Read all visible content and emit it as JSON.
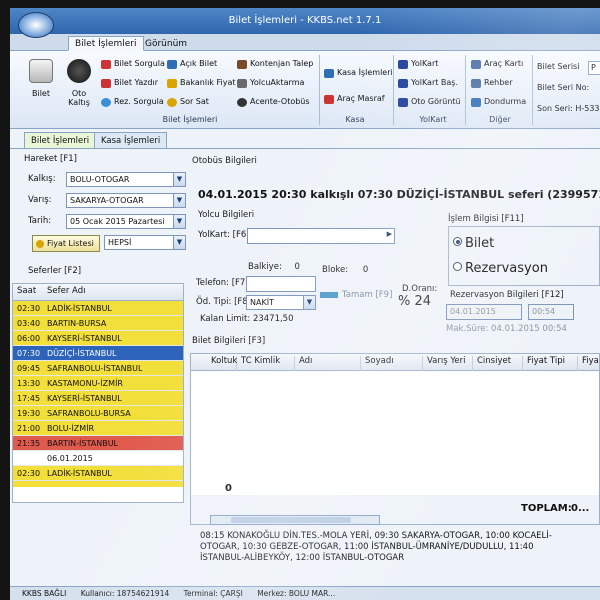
{
  "window": {
    "title": "Bilet İşlemleri - KKBS.net 1.7.1"
  },
  "ribbon_tabs": [
    "Bilet İşlemleri",
    "Görünüm"
  ],
  "ribbon": {
    "bilet_group": {
      "big_buttons": [
        "Bilet",
        "Oto Kaltış"
      ],
      "col1": [
        "Bilet Sorgula",
        "Bilet Yazdır",
        "Rez. Sorgula"
      ],
      "col2": [
        "Açık Bilet",
        "Bakanlık Fiyat",
        "Sor Sat"
      ],
      "col3": [
        "Kontenjan Talep",
        "YolcuAktarma",
        "Acente-Otobüs"
      ],
      "label": "Bilet İşlemleri"
    },
    "kasa_group": {
      "items": [
        "Kasa İşlemleri",
        "Araç Masraf"
      ],
      "label": "Kasa"
    },
    "yolkart_group": {
      "items": [
        "YolKart",
        "YolKart Baş.",
        "Oto Görüntü"
      ],
      "label": "YolKart"
    },
    "diger_group": {
      "items": [
        "Araç Kartı",
        "Rehber",
        "Dondurma"
      ],
      "label": "Diğer"
    },
    "serial": {
      "seri_label": "Bilet Serisi",
      "seri_value": "P",
      "no_label": "Bilet Seri No:",
      "son_label": "Son Seri: H-5339"
    }
  },
  "sub_tabs": [
    "Bilet İşlemleri",
    "Kasa İşlemleri"
  ],
  "left": {
    "hareket_label": "Hareket [F1]",
    "kalkis_label": "Kalkış:",
    "kalkis_value": "BOLU-OTOGAR",
    "varis_label": "Varış:",
    "varis_value": "SAKARYA-OTOGAR",
    "tarih_label": "Tarih:",
    "tarih_value": "05 Ocak 2015 Pazartesi",
    "fiyat_button": "Fiyat Listesi",
    "fiyat_combo": "HEPSİ",
    "seferler_label": "Seferler [F2]",
    "columns": [
      "Saat",
      "Sefer Adı"
    ],
    "trips": [
      {
        "time": "02:30",
        "name": "LADİK-İSTANBUL",
        "color": "#f2df3a"
      },
      {
        "time": "03:40",
        "name": "BARTIN-BURSA",
        "color": "#f2df3a"
      },
      {
        "time": "06:00",
        "name": "KAYSERİ-İSTANBUL",
        "color": "#f2df3a"
      },
      {
        "time": "07:30",
        "name": "DÜZİÇİ-İSTANBUL",
        "color": "#2d63b8"
      },
      {
        "time": "09:45",
        "name": "SAFRANBOLU-İSTANBUL",
        "color": "#f2df3a"
      },
      {
        "time": "13:30",
        "name": "KASTAMONU-İZMİR",
        "color": "#f2df3a"
      },
      {
        "time": "17:45",
        "name": "KAYSERİ-İSTANBUL",
        "color": "#f2df3a"
      },
      {
        "time": "19:30",
        "name": "SAFRANBOLU-BURSA",
        "color": "#f2df3a"
      },
      {
        "time": "21:00",
        "name": "BOLU-İZMİR",
        "color": "#f2df3a"
      },
      {
        "time": "21:35",
        "name": "BARTIN-İSTANBUL",
        "color": "#e05a4e"
      },
      {
        "time": "",
        "name": "06.01.2015",
        "color": "#ffffff"
      },
      {
        "time": "02:30",
        "name": "LADİK-İSTANBUL",
        "color": "#f2df3a"
      }
    ]
  },
  "right": {
    "otobus_label": "Otobüs Bilgileri",
    "trip_title": "04.01.2015 20:30 kalkışlı 07:30 DÜZİÇİ-İSTANBUL seferi (2399571)",
    "yolcu_label": "Yolcu Bilgileri",
    "yolkart_label": "YolKart: [F6]",
    "islem_label": "İşlem Bilgisi [F11]",
    "radio_bilet": "Bilet",
    "radio_rez": "Rezervasyon",
    "bekleme_label": "Balkiye:",
    "bekleme_value": "0",
    "bloke_label": "Bloke:",
    "bloke_value": "0",
    "telefon_label": "Telefon: [F7]",
    "odtipi_label": "Öd. Tipi: [F8]",
    "odtipi_value": "NAKİT",
    "tamam_label": "Tamam [F9]",
    "doran_label": "D.Oranı:",
    "doran_value": "% 24",
    "kalan_label": "Kalan Limit:",
    "kalan_value": "23471,50",
    "rez_label": "Rezervasyon Bilgileri [F12]",
    "rez_date": "04.01.2015",
    "rez_time": "00:54",
    "maksure": "Mak.Süre: 04.01.2015 00:54",
    "bilet_bilgileri": "Bilet Bilgileri [F3]",
    "grid_columns": [
      "Koltuk",
      "TC Kimlik",
      "Adı",
      "Soyadı",
      "Varış Yeri",
      "Cinsiyet",
      "Fiyat Tipi",
      "Fiyat"
    ],
    "count_value": "0",
    "toplam_label": "TOPLAM:",
    "toplam_value": "0..."
  },
  "route_text": "08:15 KONAKOĞLU DİN.TES.-MOLA YERİ, 09:30 SAKARYA-OTOGAR, 10:00 KOCAELİ-OTOGAR, 10:30 GEBZE-OTOGAR, 11:00 İSTANBUL-ÜMRANİYE/DUDULLU, 11:40 İSTANBUL-ALİBEYKÖY, 12:00 İSTANBUL-OTOGAR",
  "statusbar": {
    "a": "KKBS BAĞLI",
    "b": "Kullanıcı: 18754621914",
    "c": "Terminal: ÇARŞI",
    "d": "Merkez: BOLU MAR..."
  }
}
